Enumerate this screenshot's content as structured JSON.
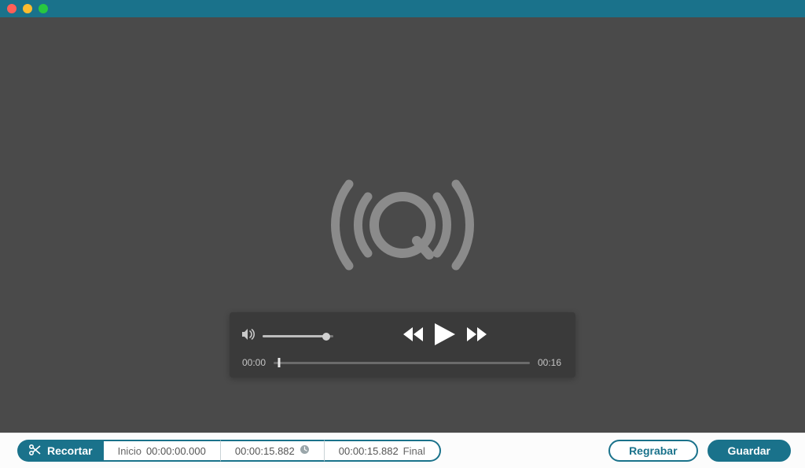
{
  "player": {
    "volume_percent": 90,
    "time_current": "00:00",
    "time_total": "00:16",
    "progress_percent": 2
  },
  "trim": {
    "button_label": "Recortar",
    "start_label": "Inicio",
    "start_value": "00:00:00.000",
    "duration_value": "00:00:15.882",
    "end_value": "00:00:15.882",
    "end_label": "Final"
  },
  "actions": {
    "rerecord_label": "Regrabar",
    "save_label": "Guardar"
  }
}
